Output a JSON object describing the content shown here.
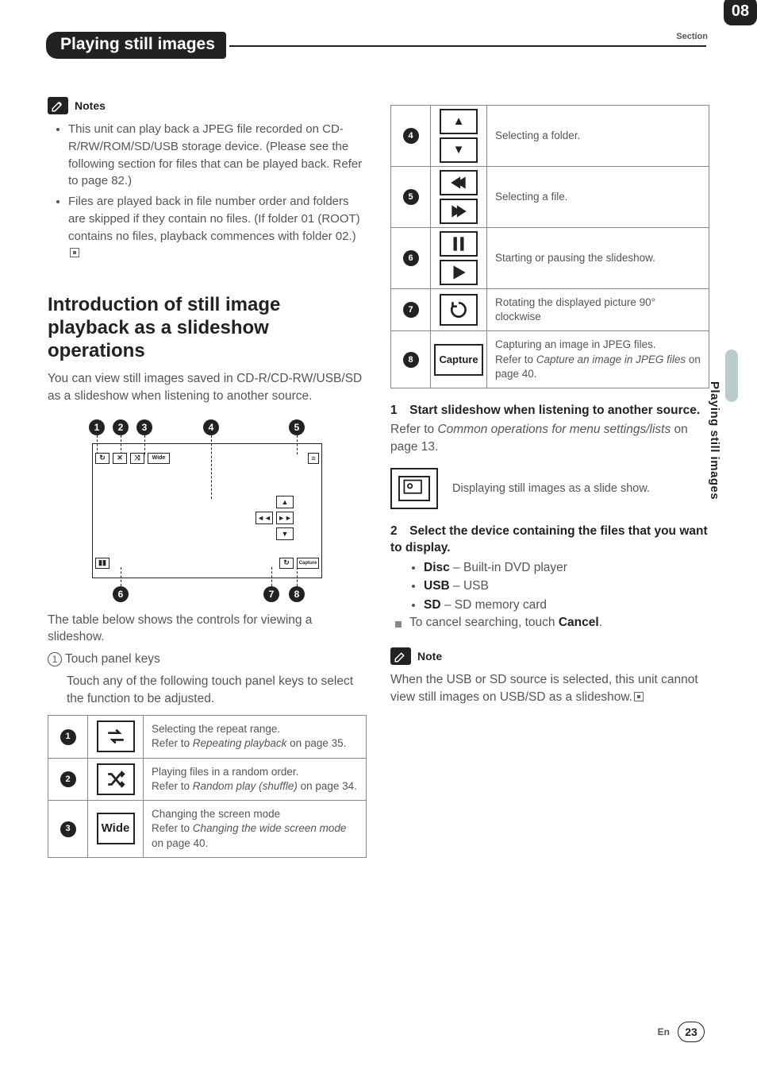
{
  "section_label": "Section",
  "section_number": "08",
  "page_title": "Playing still images",
  "side_tab": "Playing still images",
  "notes": {
    "heading": "Notes",
    "items": [
      "This unit can play back a JPEG file recorded on CD-R/RW/ROM/SD/USB storage device. (Please see the following section for files that can be played back. Refer to page 82.)",
      "Files are played back in file number order and folders are skipped if they contain no files. (If folder 01 (ROOT) contains no files, playback commences with folder 02.)"
    ]
  },
  "intro": {
    "heading": "Introduction of still image playback as a slideshow operations",
    "body": "You can view still images saved in CD-R/CD-RW/USB/SD as a slideshow when listening to another source.",
    "caption": "The table below shows the controls for viewing a slideshow.",
    "touch_label_num": "1",
    "touch_label": "Touch panel keys",
    "touch_desc": "Touch any of the following touch panel keys to select the function to be adjusted."
  },
  "controls_left": [
    {
      "n": "1",
      "icon": "repeat",
      "label": "",
      "desc_a": "Selecting the repeat range.",
      "ref": "Repeating playback",
      "desc_b": " on page 35."
    },
    {
      "n": "2",
      "icon": "shuffle",
      "label": "",
      "desc_a": "Playing files in a random order.",
      "ref": "Random play (shuffle)",
      "desc_b": " on page 34."
    },
    {
      "n": "3",
      "icon": "text",
      "label": "Wide",
      "desc_a": "Changing the screen mode",
      "ref": "Changing the wide screen mode",
      "desc_b": " on page 40."
    }
  ],
  "controls_right": [
    {
      "n": "4",
      "icon": "updown",
      "desc": "Selecting a folder."
    },
    {
      "n": "5",
      "icon": "prevnext",
      "desc": "Selecting a file."
    },
    {
      "n": "6",
      "icon": "pauseplay",
      "desc": "Starting or pausing the slideshow."
    },
    {
      "n": "7",
      "icon": "rotate",
      "desc": "Rotating the displayed picture 90° clockwise"
    },
    {
      "n": "8",
      "icon": "text",
      "label": "Capture",
      "desc_a": "Capturing an image in JPEG files.",
      "ref": "Capture an image in JPEG files",
      "desc_b": " on page 40."
    }
  ],
  "steps": {
    "s1_head": "1 Start slideshow when listening to another source.",
    "s1_body_a": "Refer to ",
    "s1_ref": "Common operations for menu settings/lists",
    "s1_body_b": " on page 13.",
    "slide_icon_desc": "Displaying still images as a slide show.",
    "s2_head": "2 Select the device containing the files that you want to display.",
    "devices": [
      {
        "name": "Disc",
        "desc": " – Built-in DVD player"
      },
      {
        "name": "USB",
        "desc": " – USB"
      },
      {
        "name": "SD",
        "desc": " – SD memory card"
      }
    ],
    "cancel_a": "To cancel searching, touch ",
    "cancel_b": "Cancel",
    "cancel_c": "."
  },
  "note2": {
    "heading": "Note",
    "body": "When the USB or SD source is selected, this unit cannot view still images on USB/SD as a slideshow."
  },
  "footer": {
    "lang": "En",
    "page": "23"
  },
  "illus_labels": {
    "wide": "Wide",
    "capture": "Capture"
  }
}
